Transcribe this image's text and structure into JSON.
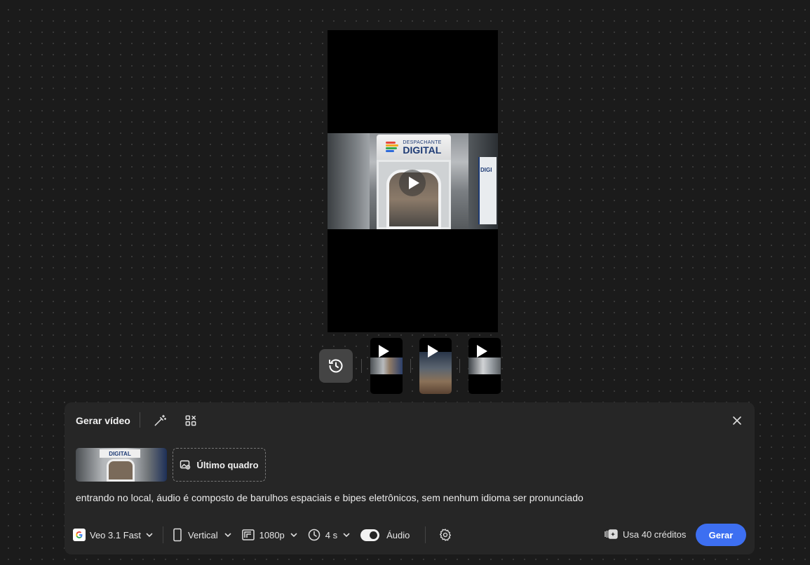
{
  "preview": {
    "sign_small": "DESPACHANTE",
    "sign_big": "DIGITAL",
    "side_sign": "DIGI"
  },
  "thumbnails": [
    {
      "name": "clip-1"
    },
    {
      "name": "clip-2"
    },
    {
      "name": "clip-3"
    }
  ],
  "panel": {
    "title": "Gerar vídeo",
    "last_frame_label": "Último quadro",
    "ref_sign": "DIGITAL",
    "prompt": "entrando no local, áudio é composto de barulhos espaciais e bipes eletrônicos, sem nenhum idioma ser pronunciado"
  },
  "toolbar": {
    "model": "Veo 3.1 Fast",
    "aspect": "Vertical",
    "resolution": "1080p",
    "duration": "4 s",
    "audio_label": "Áudio",
    "audio_on": true
  },
  "credits_label": "Usa 40 créditos",
  "generate_label": "Gerar",
  "colors": {
    "accent": "#3d6ff1",
    "panel_bg": "#262626",
    "canvas_bg": "#1b1b1b"
  },
  "icons": [
    "history-icon",
    "magic-wand-icon",
    "grid-settings-icon",
    "close-icon",
    "image-icon",
    "google-icon",
    "chevron-down-icon",
    "phone-icon",
    "resolution-icon",
    "clock-icon",
    "gear-icon",
    "credits-icon",
    "play-icon"
  ]
}
